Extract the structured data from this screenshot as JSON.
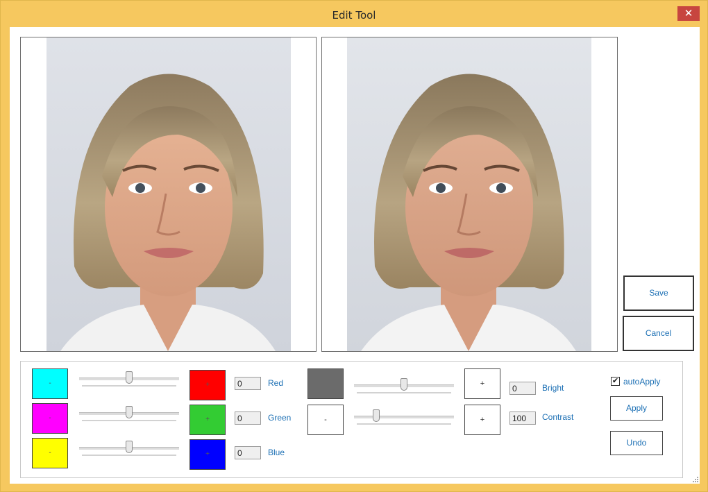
{
  "window": {
    "title": "Edit Tool",
    "close_glyph": "✕"
  },
  "buttons": {
    "save": "Save",
    "cancel": "Cancel",
    "apply": "Apply",
    "undo": "Undo"
  },
  "rgb_controls": [
    {
      "left_swatch_color": "#00ffff",
      "left_swatch_label": "-",
      "slider_level": 0.5,
      "right_swatch_color": "#ff0000",
      "right_swatch_label": "+",
      "value": "0",
      "label": "Red"
    },
    {
      "left_swatch_color": "#ff00ff",
      "left_swatch_label": "-",
      "slider_level": 0.5,
      "right_swatch_color": "#33cc33",
      "right_swatch_label": "+",
      "value": "0",
      "label": "Green"
    },
    {
      "left_swatch_color": "#ffff00",
      "left_swatch_label": "-",
      "slider_level": 0.5,
      "right_swatch_color": "#0000ff",
      "right_swatch_label": "+",
      "value": "0",
      "label": "Blue"
    }
  ],
  "brightness": {
    "minus_swatch_color": "#6b6b6b",
    "plus_label": "+",
    "slider_level": 0.5,
    "value": "0",
    "label": "Bright"
  },
  "contrast": {
    "minus_label": "-",
    "plus_label": "+",
    "slider_level": 0.2,
    "value": "100",
    "label": "Contrast"
  },
  "auto_apply": {
    "label": "autoApply",
    "checked": true,
    "check_glyph": "✔"
  },
  "colors": {
    "accent_text": "#1b6fb4",
    "title_bar": "#f6c85f",
    "close_button": "#c7453f"
  }
}
